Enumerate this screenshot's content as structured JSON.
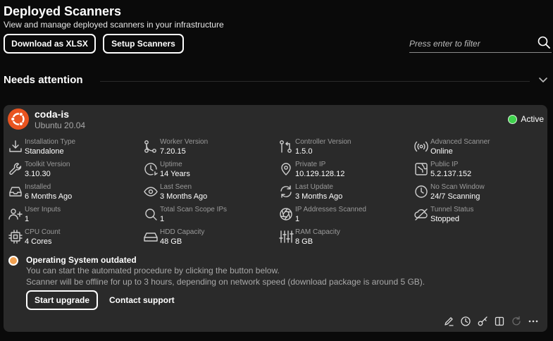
{
  "header": {
    "title": "Deployed Scanners",
    "subtitle": "View and manage deployed scanners in your infrastructure",
    "download_label": "Download as XLSX",
    "setup_label": "Setup Scanners",
    "filter_placeholder": "Press enter to filter"
  },
  "section": {
    "title": "Needs attention"
  },
  "scanner": {
    "name": "coda-is",
    "os": "Ubuntu 20.04",
    "status": "Active",
    "status_color": "#3fd24d",
    "logo_color": "#e95420",
    "fields": [
      {
        "label": "Installation Type",
        "value": "Standalone",
        "icon": "download-icon"
      },
      {
        "label": "Worker Version",
        "value": "7.20.15",
        "icon": "branch-icon"
      },
      {
        "label": "Controller Version",
        "value": "1.5.0",
        "icon": "git-compare-icon"
      },
      {
        "label": "Advanced Scanner",
        "value": "Online",
        "icon": "broadcast-icon"
      },
      {
        "label": "Toolkit Version",
        "value": "3.10.30",
        "icon": "wrench-icon"
      },
      {
        "label": "Uptime",
        "value": "14 Years",
        "icon": "clock-arrow-icon"
      },
      {
        "label": "Private IP",
        "value": "10.129.128.12",
        "icon": "location-pin-icon"
      },
      {
        "label": "Public IP",
        "value": "5.2.137.152",
        "icon": "globe-icon"
      },
      {
        "label": "Installed",
        "value": "6 Months Ago",
        "icon": "inbox-icon"
      },
      {
        "label": "Last Seen",
        "value": "3 Months Ago",
        "icon": "eye-icon"
      },
      {
        "label": "Last Update",
        "value": "3 Months Ago",
        "icon": "refresh-icon"
      },
      {
        "label": "No Scan Window",
        "value": "24/7 Scanning",
        "icon": "clock-icon"
      },
      {
        "label": "User Inputs",
        "value": "1",
        "icon": "user-add-icon"
      },
      {
        "label": "Total Scan Scope IPs",
        "value": "1",
        "icon": "search-icon"
      },
      {
        "label": "IP Addresses Scanned",
        "value": "1",
        "icon": "aperture-icon"
      },
      {
        "label": "Tunnel Status",
        "value": "Stopped",
        "icon": "cloud-off-icon"
      },
      {
        "label": "CPU Count",
        "value": "4 Cores",
        "icon": "cpu-icon"
      },
      {
        "label": "HDD Capacity",
        "value": "48 GB",
        "icon": "hard-drive-icon"
      },
      {
        "label": "RAM Capacity",
        "value": "8 GB",
        "icon": "sliders-icon"
      }
    ],
    "alert": {
      "title": "Operating System outdated",
      "line1": "You can start the automated procedure by clicking the button below.",
      "line2": "Scanner will be offline for up to 3 hours, depending on network speed (download package is around 5 GB).",
      "upgrade_label": "Start upgrade",
      "support_label": "Contact support",
      "dot_color": "#f0a050"
    },
    "actions": [
      "edit-icon",
      "history-icon",
      "key-icon",
      "columns-icon",
      "reload-icon",
      "more-icon"
    ]
  }
}
